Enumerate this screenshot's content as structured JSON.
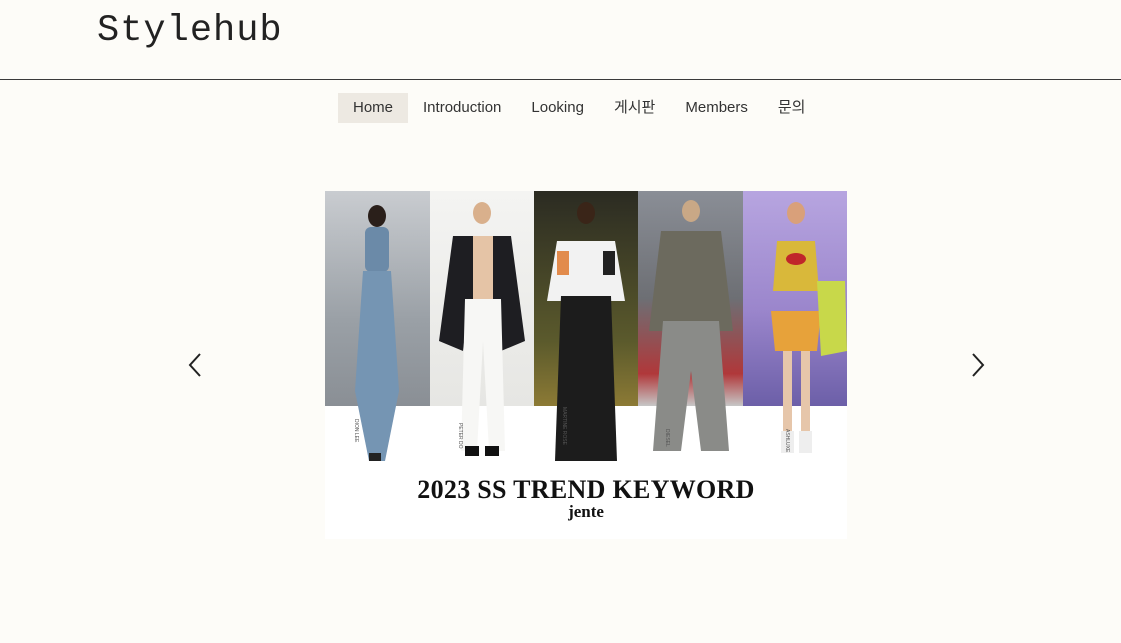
{
  "site": {
    "logo": "Stylehub"
  },
  "nav": {
    "items": [
      {
        "label": "Home",
        "active": true
      },
      {
        "label": "Introduction",
        "active": false
      },
      {
        "label": "Looking",
        "active": false
      },
      {
        "label": "게시판",
        "active": false
      },
      {
        "label": "Members",
        "active": false
      },
      {
        "label": "문의",
        "active": false
      }
    ]
  },
  "slideshow": {
    "title": "2023 SS TREND KEYWORD",
    "brand": "jente",
    "designers": [
      "DION LEE",
      "PETER DO",
      "MARTINE ROSE",
      "DIESEL",
      "ASHLUXE"
    ],
    "prev_icon": "chevron-left-icon",
    "next_icon": "chevron-right-icon"
  },
  "colors": {
    "background": "#fdfcf8",
    "nav_active": "#ede9e2",
    "text": "#333333"
  }
}
